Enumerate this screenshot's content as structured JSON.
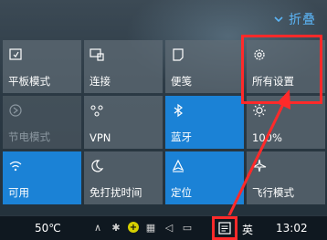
{
  "header": {
    "collapse_label": "折叠"
  },
  "tiles": [
    {
      "label": "平板模式",
      "icon": "tablet-mode-icon"
    },
    {
      "label": "连接",
      "icon": "connect-icon"
    },
    {
      "label": "便笺",
      "icon": "note-icon"
    },
    {
      "label": "所有设置",
      "icon": "gear-icon"
    },
    {
      "label": "节电模式",
      "icon": "battery-saver-icon"
    },
    {
      "label": "VPN",
      "icon": "vpn-icon"
    },
    {
      "label": "蓝牙",
      "icon": "bluetooth-icon"
    },
    {
      "label": "100%",
      "icon": "brightness-icon"
    },
    {
      "label": "可用",
      "icon": "wifi-icon"
    },
    {
      "label": "免打扰时间",
      "icon": "moon-icon"
    },
    {
      "label": "定位",
      "icon": "location-icon"
    },
    {
      "label": "飞行模式",
      "icon": "airplane-icon"
    }
  ],
  "taskbar": {
    "temperature": "50℃",
    "language": "英",
    "time": "13:02"
  },
  "colors": {
    "accent": "#1b82d6",
    "annotation_red": "#ff2a2a",
    "link_blue": "#5bb4f5"
  }
}
